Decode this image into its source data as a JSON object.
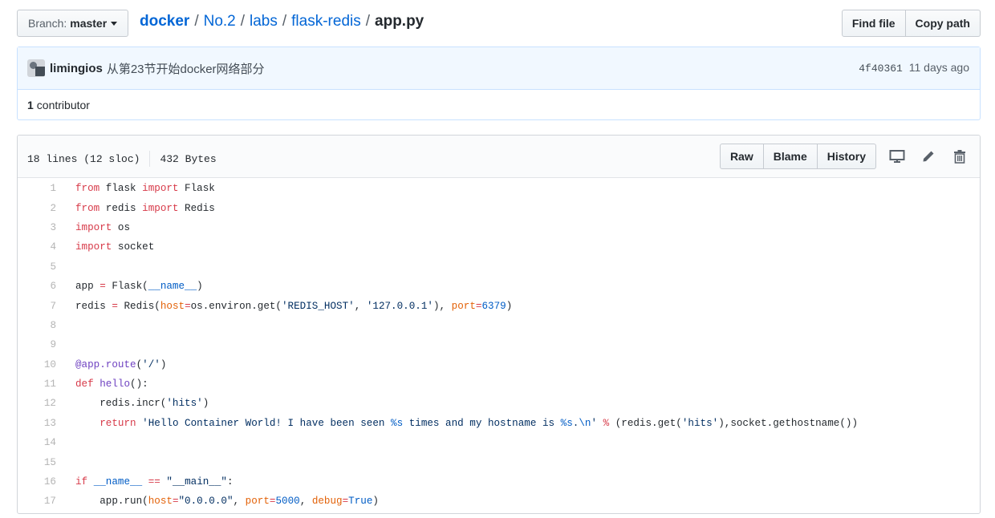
{
  "branch": {
    "label": "Branch:",
    "value": "master"
  },
  "breadcrumb": {
    "root": "docker",
    "parts": [
      "No.2",
      "labs",
      "flask-redis"
    ],
    "file": "app.py"
  },
  "header_actions": {
    "find_file": "Find file",
    "copy_path": "Copy path"
  },
  "commit": {
    "author": "limingios",
    "message": "从第23节开始docker网络部分",
    "sha": "4f40361",
    "age": "11 days ago"
  },
  "contributors": {
    "count": "1",
    "label": "contributor"
  },
  "file": {
    "lines_info": "18 lines (12 sloc)",
    "size": "432 Bytes",
    "actions": {
      "raw": "Raw",
      "blame": "Blame",
      "history": "History"
    },
    "icons": [
      "desktop-icon",
      "pencil-icon",
      "trash-icon"
    ]
  },
  "code_lines": [
    "from flask import Flask",
    "from redis import Redis",
    "import os",
    "import socket",
    "",
    "app = Flask(__name__)",
    "redis = Redis(host=os.environ.get('REDIS_HOST', '127.0.0.1'), port=6379)",
    "",
    "",
    "@app.route('/')",
    "def hello():",
    "    redis.incr('hits')",
    "    return 'Hello Container World! I have been seen %s times and my hostname is %s.\\n' % (redis.get('hits'),socket.gethostname())",
    "",
    "",
    "if __name__ == \"__main__\":",
    "    app.run(host=\"0.0.0.0\", port=5000, debug=True)"
  ],
  "colors": {
    "link": "#0366d6",
    "keyword": "#d73a49",
    "string": "#032f62",
    "number": "#005cc5",
    "decorator": "#6f42c1",
    "param": "#e36209",
    "commit_bg": "#f1f8ff"
  }
}
